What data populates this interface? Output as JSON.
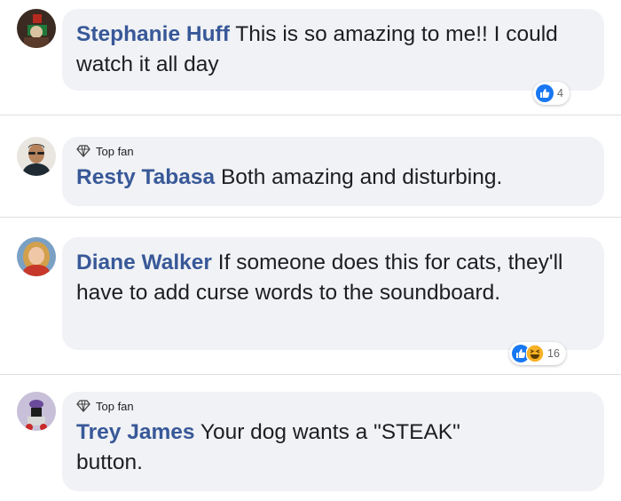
{
  "comments": [
    {
      "name": "Stephanie Huff",
      "text": " This is so amazing to me!! I could watch it all day",
      "top_fan": "",
      "reactions": {
        "icons": [
          "like-icon"
        ],
        "count": "4"
      }
    },
    {
      "name": "Resty Tabasa",
      "text": " Both amazing and disturbing.",
      "top_fan": "Top fan",
      "reactions": null
    },
    {
      "name": "Diane Walker",
      "text": " If someone does this for cats, they'll have to add curse words to the soundboard.",
      "top_fan": "",
      "reactions": {
        "icons": [
          "like-icon",
          "haha-icon"
        ],
        "count": "16"
      }
    },
    {
      "name": "Trey James",
      "text": " Your dog wants a \"STEAK\" button.",
      "top_fan": "Top fan",
      "reactions": null
    }
  ],
  "colors": {
    "name": "#385898",
    "bubble": "#f0f2f5",
    "like": "#1877f2",
    "haha": "#f7b125",
    "divider": "#dcdfe3"
  }
}
